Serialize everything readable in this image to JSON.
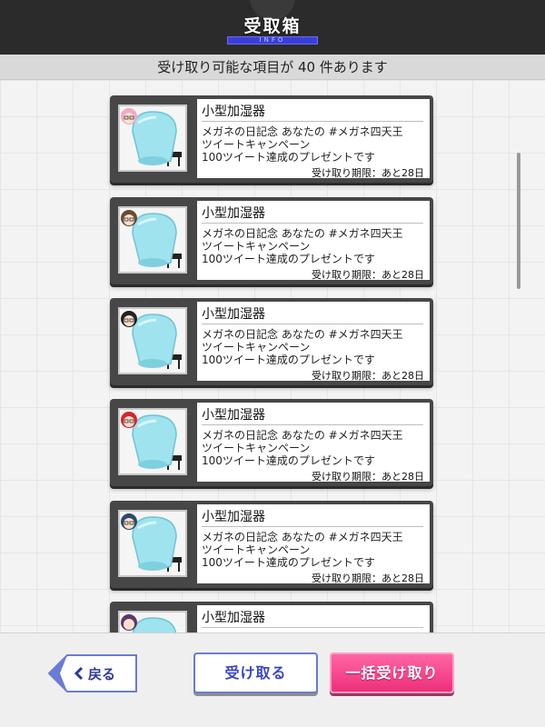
{
  "header": {
    "title": "受取箱",
    "subtitle": "INFO"
  },
  "notice": "受け取り可能な項目が 40 件あります",
  "items": [
    {
      "title": "小型加湿器",
      "desc1": "メガネの日記念 あなたの #メガネ四天王",
      "desc2": "ツイートキャンペーン",
      "desc3": "100ツイート達成のプレゼントです",
      "deadline": "受け取り期限：あと28日",
      "hair_color": "#f4a7c4"
    },
    {
      "title": "小型加湿器",
      "desc1": "メガネの日記念 あなたの #メガネ四天王",
      "desc2": "ツイートキャンペーン",
      "desc3": "100ツイート達成のプレゼントです",
      "deadline": "受け取り期限：あと28日",
      "hair_color": "#6b4a36"
    },
    {
      "title": "小型加湿器",
      "desc1": "メガネの日記念 あなたの #メガネ四天王",
      "desc2": "ツイートキャンペーン",
      "desc3": "100ツイート達成のプレゼントです",
      "deadline": "受け取り期限：あと28日",
      "hair_color": "#222222"
    },
    {
      "title": "小型加湿器",
      "desc1": "メガネの日記念 あなたの #メガネ四天王",
      "desc2": "ツイートキャンペーン",
      "desc3": "100ツイート達成のプレゼントです",
      "deadline": "受け取り期限：あと28日",
      "hair_color": "#d8252a"
    },
    {
      "title": "小型加湿器",
      "desc1": "メガネの日記念 あなたの #メガネ四天王",
      "desc2": "ツイートキャンペーン",
      "desc3": "100ツイート達成のプレゼントです",
      "deadline": "受け取り期限：あと28日",
      "hair_color": "#2c4a6e"
    },
    {
      "title": "小型加湿器",
      "hair_color": "#5a3a6a"
    }
  ],
  "footer": {
    "back_label": "戻る",
    "receive_label": "受け取る",
    "bulk_label": "一括受け取り"
  },
  "colors": {
    "accent_blue": "#3a47c3",
    "accent_pink": "#ee2f7c",
    "humidifier": "#9fe3ef"
  }
}
